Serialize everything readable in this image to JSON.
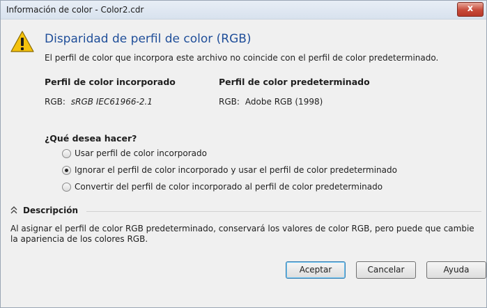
{
  "window": {
    "title": "Información de color - Color2.cdr",
    "close_label": "x"
  },
  "header": {
    "icon": "warning-icon",
    "heading": "Disparidad de perfil de color (RGB)",
    "subtext": "El perfil de color que incorpora este archivo no coincide con el perfil de color predeterminado."
  },
  "profiles": {
    "embedded": {
      "title": "Perfil de color incorporado",
      "mode": "RGB:",
      "name": "sRGB IEC61966-2.1"
    },
    "default": {
      "title": "Perfil de color predeterminado",
      "mode": "RGB:",
      "name": "Adobe RGB (1998)"
    }
  },
  "question": {
    "label": "¿Qué desea hacer?",
    "options": [
      {
        "label": "Usar perfil de color incorporado",
        "selected": false
      },
      {
        "label": "Ignorar el perfil de color incorporado y usar el perfil de color predeterminado",
        "selected": true
      },
      {
        "label": "Convertir del perfil de color incorporado al perfil de color predeterminado",
        "selected": false
      }
    ]
  },
  "description": {
    "label": "Descripción",
    "icon": "chevron-up-double-icon",
    "text": "Al asignar el perfil de color RGB predeterminado, conservará los valores de color RGB, pero puede que cambie la apariencia de los colores RGB."
  },
  "buttons": {
    "ok": "Aceptar",
    "cancel": "Cancelar",
    "help": "Ayuda"
  }
}
